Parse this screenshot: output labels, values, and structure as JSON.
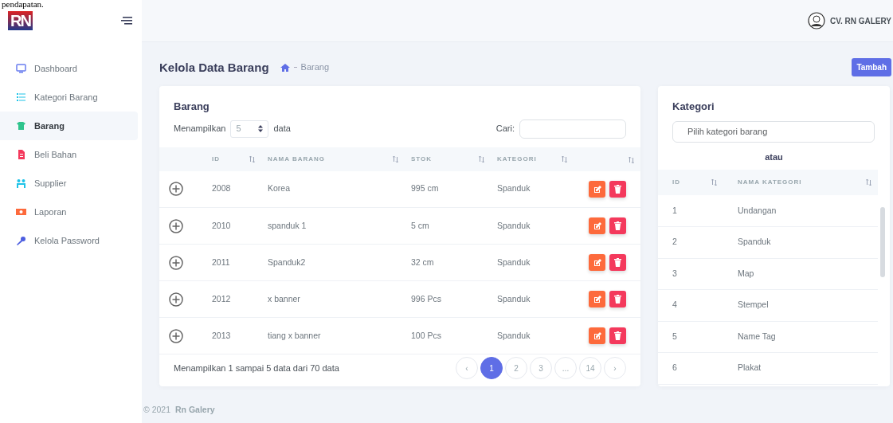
{
  "top_text": "pendapatan.",
  "brand": {
    "logo_text": "RN"
  },
  "sidebar": {
    "items": [
      {
        "label": "Dashboard",
        "selected": false
      },
      {
        "label": "Kategori Barang",
        "selected": false
      },
      {
        "label": "Barang",
        "selected": true
      },
      {
        "label": "Beli Bahan",
        "selected": false
      },
      {
        "label": "Supplier",
        "selected": false
      },
      {
        "label": "Laporan",
        "selected": false
      },
      {
        "label": "Kelola Password",
        "selected": false
      }
    ]
  },
  "topbar": {
    "user": "CV. RN GALERY"
  },
  "page": {
    "title": "Kelola Data Barang",
    "breadcrumb": "Barang",
    "add_button": "Tambah"
  },
  "barang": {
    "title": "Barang",
    "show_label": "Menampilkan",
    "show_value": "5",
    "show_suffix": "data",
    "search_label": "Cari:",
    "columns": [
      "ID",
      "NAMA BARANG",
      "STOK",
      "KATEGORI"
    ],
    "rows": [
      {
        "id": "2008",
        "nama": "Korea",
        "stok": "995 cm",
        "kategori": "Spanduk"
      },
      {
        "id": "2010",
        "nama": "spanduk 1",
        "stok": "5 cm",
        "kategori": "Spanduk"
      },
      {
        "id": "2011",
        "nama": "Spanduk2",
        "stok": "32 cm",
        "kategori": "Spanduk"
      },
      {
        "id": "2012",
        "nama": "x banner",
        "stok": "996 Pcs",
        "kategori": "Spanduk"
      },
      {
        "id": "2013",
        "nama": "tiang x banner",
        "stok": "100 Pcs",
        "kategori": "Spanduk"
      }
    ],
    "info": "Menampilkan 1 sampai 5 data dari 70 data",
    "pagination": [
      {
        "label": "‹",
        "selected": false
      },
      {
        "label": "1",
        "selected": true
      },
      {
        "label": "2",
        "selected": false
      },
      {
        "label": "3",
        "selected": false
      },
      {
        "label": "...",
        "selected": false
      },
      {
        "label": "14",
        "selected": false
      },
      {
        "label": "›",
        "selected": false
      }
    ]
  },
  "kategori": {
    "title": "Kategori",
    "placeholder": "Pilih kategori barang",
    "separator": "atau",
    "columns": [
      "ID",
      "NAMA KATEGORI"
    ],
    "rows": [
      {
        "id": "1",
        "nama": "Undangan"
      },
      {
        "id": "2",
        "nama": "Spanduk"
      },
      {
        "id": "3",
        "nama": "Map"
      },
      {
        "id": "4",
        "nama": "Stempel"
      },
      {
        "id": "5",
        "nama": "Name Tag"
      },
      {
        "id": "6",
        "nama": "Plakat"
      }
    ]
  },
  "footer": {
    "copyright": "© 2021",
    "link": "Rn Galery"
  }
}
